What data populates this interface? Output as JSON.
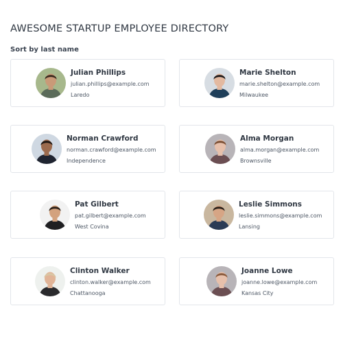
{
  "header": {
    "title": "AWESOME STARTUP EMPLOYEE DIRECTORY",
    "sort_label": "Sort by last name"
  },
  "employees": [
    {
      "name": "Julian Phillips",
      "email": "julian.phillips@example.com",
      "city": "Laredo",
      "skin": "#c99a78",
      "hair": "#3a2a1e",
      "shirt": "#5b6b5a",
      "bg": "#a7b88c"
    },
    {
      "name": "Marie Shelton",
      "email": "marie.shelton@example.com",
      "city": "Milwaukee",
      "skin": "#e3b9a0",
      "hair": "#1e1b1c",
      "shirt": "#1f3f5a",
      "bg": "#d7dde3"
    },
    {
      "name": "Norman Crawford",
      "email": "norman.crawford@example.com",
      "city": "Independence",
      "skin": "#9c6b4e",
      "hair": "#1e1713",
      "shirt": "#1f2430",
      "bg": "#cfd8e2"
    },
    {
      "name": "Alma Morgan",
      "email": "alma.morgan@example.com",
      "city": "Brownsville",
      "skin": "#e7c0ab",
      "hair": "#7a4e33",
      "shirt": "#6b4e52",
      "bg": "#b8b4b8"
    },
    {
      "name": "Pat Gilbert",
      "email": "pat.gilbert@example.com",
      "city": "West Covina",
      "skin": "#d3a27e",
      "hair": "#2b2018",
      "shirt": "#1f1f22",
      "bg": "#f2f2f2"
    },
    {
      "name": "Leslie Simmons",
      "email": "leslie.simmons@example.com",
      "city": "Lansing",
      "skin": "#d6a585",
      "hair": "#2a2019",
      "shirt": "#2a3b55",
      "bg": "#c9b79f"
    },
    {
      "name": "Clinton Walker",
      "email": "clinton.walker@example.com",
      "city": "Chattanooga",
      "skin": "#e1b497",
      "hair": "#d9c6a3",
      "shirt": "#2a2a2d",
      "bg": "#eef1ee"
    },
    {
      "name": "Joanne Lowe",
      "email": "joanne.lowe@example.com",
      "city": "Kansas City",
      "skin": "#e7c0ab",
      "hair": "#8a5a3c",
      "shirt": "#6b4e52",
      "bg": "#b8b4b8"
    }
  ]
}
